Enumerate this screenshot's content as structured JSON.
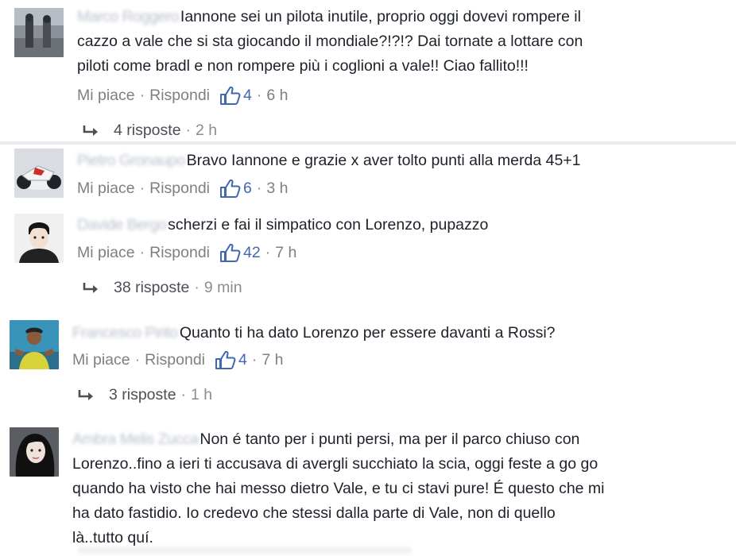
{
  "comments": [
    {
      "author": "Marco Roggero",
      "text": "Iannone sei un pilota inutile, proprio oggi dovevi rompere il cazzo a vale che si sta giocando il mondiale?!?!? Dai tornate a lottare con piloti come bradl e non rompere più i coglioni a vale!! Ciao fallito!!!",
      "text_lines": [
        "Iannone sei un pilota inutile, proprio oggi dovevi rompere il",
        "cazzo a vale che si sta giocando il mondiale?!?!? Dai tornate a lottare con",
        "piloti come bradl e non rompere più i coglioni a vale!! Ciao fallito!!!"
      ],
      "like_label": "Mi piace",
      "reply_label": "Rispondi",
      "likes": "4",
      "time": "6 h",
      "replies_label": "4 risposte",
      "replies_time": "2 h"
    },
    {
      "author": "Pietro Gronaupo",
      "text": "Bravo Iannone e grazie x aver tolto punti alla merda 45+1",
      "like_label": "Mi piace",
      "reply_label": "Rispondi",
      "likes": "6",
      "time": "3 h"
    },
    {
      "author": "Davide Bergo",
      "text": "scherzi e fai il simpatico con Lorenzo, pupazzo",
      "like_label": "Mi piace",
      "reply_label": "Rispondi",
      "likes": "42",
      "time": "7 h",
      "replies_label": "38 risposte",
      "replies_time": "9 min"
    },
    {
      "author": "Francesco Pirito",
      "text": "Quanto ti ha dato Lorenzo per essere davanti a Rossi?",
      "like_label": "Mi piace",
      "reply_label": "Rispondi",
      "likes": "4",
      "time": "7 h",
      "replies_label": "3 risposte",
      "replies_time": "1 h"
    },
    {
      "author": "Ambra Melis Zucca",
      "text": "Non é tanto per i punti persi, ma per il parco chiuso con Lorenzo..fino a ieri ti accusava di avergli succhiato la scia, oggi feste a go go quando ha visto che hai messo dietro Vale, e tu ci stavi pure! É questo che mi ha dato fastidio. Io credevo che stessi dalla parte di Vale, non di quello là..tutto quí.",
      "text_lines": [
        "Non é tanto per i punti persi, ma per il parco chiuso con",
        "Lorenzo..fino a ieri ti accusava di avergli succhiato la scia, oggi feste a go go",
        "quando ha visto che hai messo dietro Vale, e tu ci stavi pure! É questo che mi",
        "ha dato fastidio. Io credevo che stessi dalla parte di Vale, non di quello",
        "là..tutto quí."
      ]
    }
  ],
  "colors": {
    "link_blue": "#4267b2",
    "meta_gray": "#7f7f7f",
    "text": "#1d2129",
    "separator": "#e9ebee"
  },
  "icons": {
    "like": "thumbs-up-icon",
    "reply": "reply-arrow-icon"
  }
}
